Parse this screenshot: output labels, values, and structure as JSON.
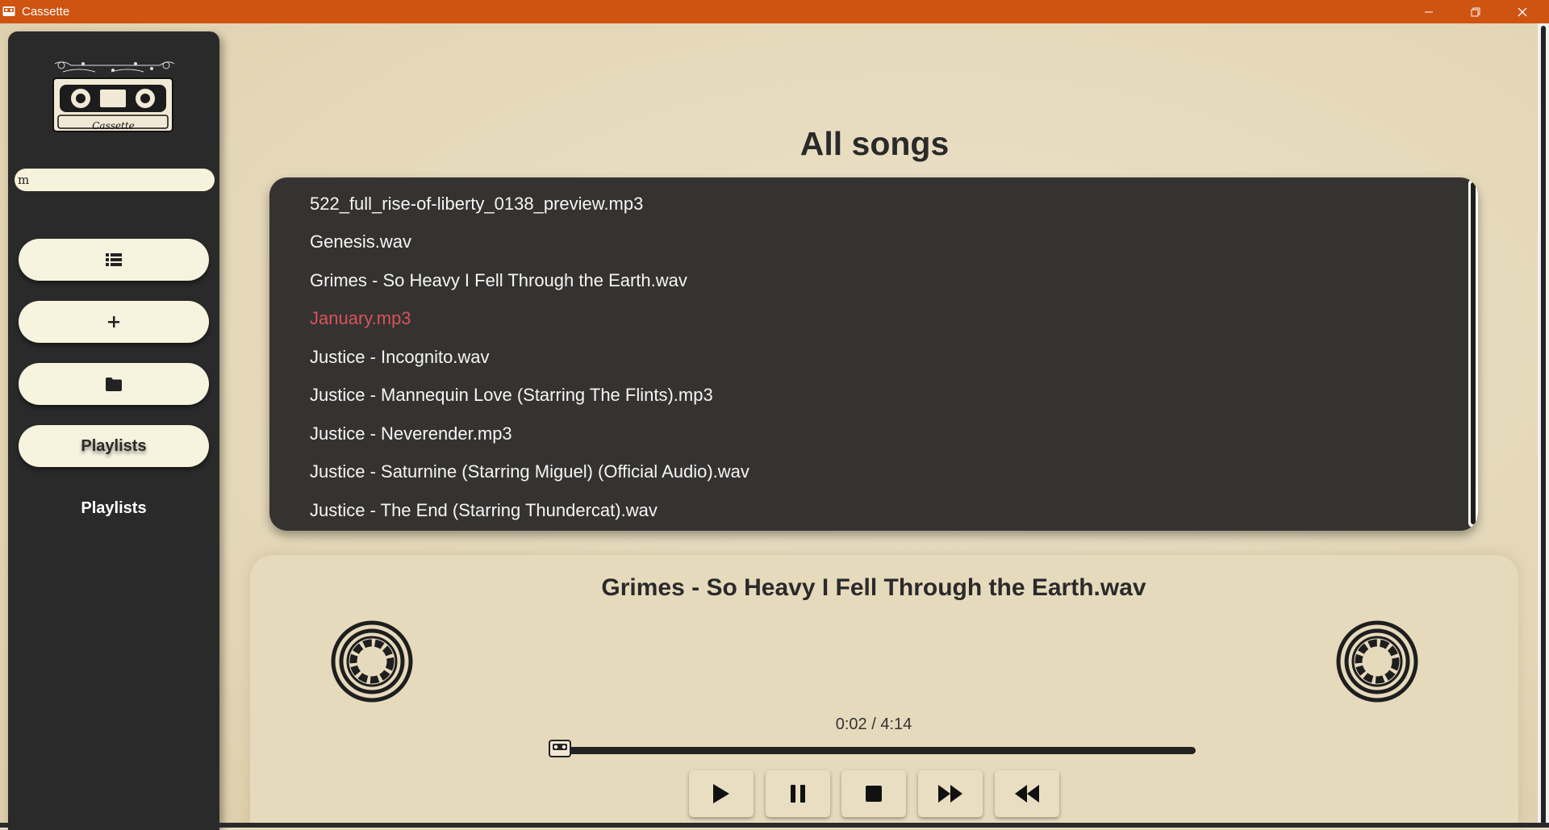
{
  "window": {
    "title": "Cassette",
    "controls": [
      "minimize-icon",
      "restore-icon",
      "close-icon"
    ],
    "accent_color": "#cf5311"
  },
  "sidebar": {
    "logo_text": "Cassette",
    "search": {
      "value": "m",
      "placeholder": ""
    },
    "buttons": [
      {
        "icon": "list-icon",
        "label": ""
      },
      {
        "icon": "plus-icon",
        "label": ""
      },
      {
        "icon": "folder-icon",
        "label": ""
      },
      {
        "icon": "",
        "label": "Playlists"
      }
    ],
    "heading": "Playlists"
  },
  "main": {
    "title": "All songs",
    "songs": [
      "522_full_rise-of-liberty_0138_preview.mp3",
      "Genesis.wav",
      "Grimes - So Heavy I Fell Through the Earth.wav",
      "January.mp3",
      "Justice - Incognito.wav",
      "Justice - Mannequin Love (Starring The Flints).mp3",
      "Justice - Neverender.mp3",
      "Justice - Saturnine (Starring Miguel) (Official Audio).wav",
      "Justice - The End (Starring Thundercat).wav"
    ],
    "active_song_index": 3,
    "active_color": "#d9525a"
  },
  "player": {
    "now_playing": "Grimes - So Heavy I Fell Through the Earth.wav",
    "time": "0:02 / 4:14",
    "progress": 0.008,
    "controls": [
      "play-icon",
      "pause-icon",
      "stop-icon",
      "fast-forward-icon",
      "rewind-icon"
    ],
    "progress_color": "#c6475a"
  }
}
